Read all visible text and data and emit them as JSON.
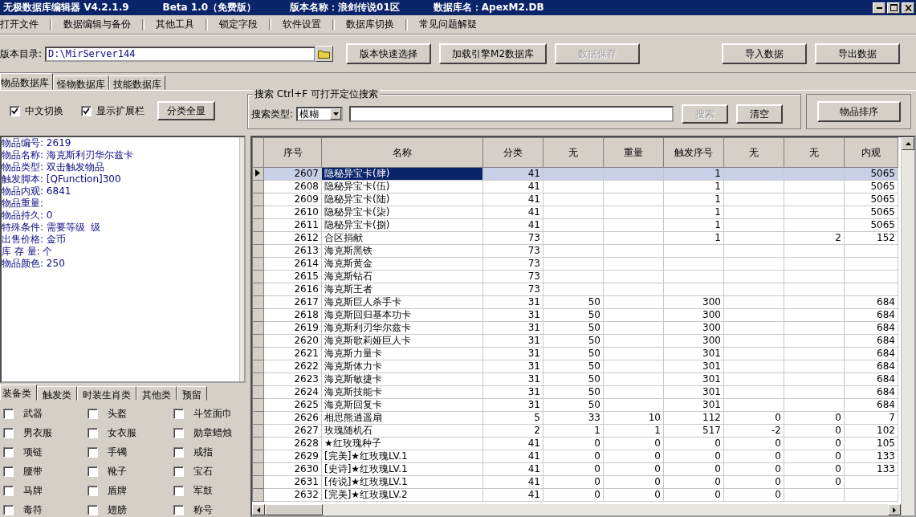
{
  "window": {
    "title_parts": [
      "无极数据库编辑器 V4.2.1.9",
      "Beta 1.0（免费版）",
      "版本名称：浪剑传说01区",
      "数据库名：ApexM2.DB"
    ]
  },
  "menu": [
    "打开文件",
    "数据编辑与备份",
    "其他工具",
    "锁定字段",
    "软件设置",
    "数据库切换",
    "常见问题解疑"
  ],
  "toolbar": {
    "dir_label": "版本目录:",
    "dir_value": "D:\\MirServer144",
    "buttons": [
      {
        "label": "版本快速选择",
        "disabled": false
      },
      {
        "label": "加载引擎M2数据库",
        "disabled": false
      },
      {
        "label": "数据保存",
        "disabled": true
      },
      {
        "label": "导入数据",
        "disabled": false
      },
      {
        "label": "导出数据",
        "disabled": false
      }
    ]
  },
  "tabs": [
    {
      "label": "物品数据库",
      "selected": true
    },
    {
      "label": "怪物数据库",
      "selected": false
    },
    {
      "label": "技能数据库",
      "selected": false
    }
  ],
  "options": [
    {
      "label": "中文切换",
      "checked": true
    },
    {
      "label": "显示扩展栏",
      "checked": true
    }
  ],
  "show_all_button": "分类全显",
  "search": {
    "title": "搜索  Ctrl+F 可打开定位搜索",
    "type_label": "搜索类型:",
    "type_value": "模糊",
    "search_button": {
      "label": "搜索",
      "disabled": true
    },
    "clear_button": "清空"
  },
  "sort_button": "物品排序",
  "details": [
    "物品编号: 2619",
    "物品名称: 海克斯利刃华尔兹卡",
    "物品类型: 双击触发物品",
    "触发脚本: [QFunction]300",
    "物品内观: 6841",
    "物品重量:",
    "物品持久: 0",
    "特殊条件: 需要等级  级",
    "出售价格: 金币",
    "库 存 量: 个",
    "物品颜色: 250"
  ],
  "category_tabs": [
    {
      "label": "装备类",
      "selected": true
    },
    {
      "label": "触发类",
      "selected": false
    },
    {
      "label": "时装生肖类",
      "selected": false
    },
    {
      "label": "其他类",
      "selected": false
    },
    {
      "label": "预留",
      "selected": false
    }
  ],
  "categories": [
    {
      "label": "武器",
      "checked": false
    },
    {
      "label": "头盔",
      "checked": false
    },
    {
      "label": "斗笠面巾",
      "checked": false
    },
    {
      "label": "男衣服",
      "checked": false
    },
    {
      "label": "女衣服",
      "checked": false
    },
    {
      "label": "勋章蜡烛",
      "checked": false
    },
    {
      "label": "项链",
      "checked": false
    },
    {
      "label": "手镯",
      "checked": false
    },
    {
      "label": "戒指",
      "checked": false
    },
    {
      "label": "腰带",
      "checked": false
    },
    {
      "label": "靴子",
      "checked": false
    },
    {
      "label": "宝石",
      "checked": false
    },
    {
      "label": "马牌",
      "checked": false
    },
    {
      "label": "盾牌",
      "checked": false
    },
    {
      "label": "军鼓",
      "checked": false
    },
    {
      "label": "毒符",
      "checked": false
    },
    {
      "label": "翅膀",
      "checked": false
    },
    {
      "label": "称号",
      "checked": false
    }
  ],
  "table": {
    "columns": [
      "序号",
      "名称",
      "分类",
      "无",
      "重量",
      "触发序号",
      "无",
      "无",
      "内观"
    ],
    "rows": [
      {
        "selected": true,
        "cells": [
          "2607",
          "隐秘异宝卡(肆)",
          "41",
          null,
          null,
          "1",
          null,
          null,
          "5065"
        ]
      },
      {
        "selected": false,
        "cells": [
          "2608",
          "隐秘异宝卡(伍)",
          "41",
          null,
          null,
          "1",
          null,
          null,
          "5065"
        ]
      },
      {
        "selected": false,
        "cells": [
          "2609",
          "隐秘异宝卡(陆)",
          "41",
          null,
          null,
          "1",
          null,
          null,
          "5065"
        ]
      },
      {
        "selected": false,
        "cells": [
          "2610",
          "隐秘异宝卡(柒)",
          "41",
          null,
          null,
          "1",
          null,
          null,
          "5065"
        ]
      },
      {
        "selected": false,
        "cells": [
          "2611",
          "隐秘异宝卡(捌)",
          "41",
          null,
          null,
          "1",
          null,
          null,
          "5065"
        ]
      },
      {
        "selected": false,
        "cells": [
          "2612",
          "合区捐献",
          "73",
          null,
          null,
          "1",
          null,
          "2",
          "152"
        ]
      },
      {
        "selected": false,
        "cells": [
          "2613",
          "海克斯黑铁",
          "73",
          null,
          null,
          null,
          null,
          null,
          null
        ]
      },
      {
        "selected": false,
        "cells": [
          "2614",
          "海克斯黄金",
          "73",
          null,
          null,
          null,
          null,
          null,
          null
        ]
      },
      {
        "selected": false,
        "cells": [
          "2615",
          "海克斯钻石",
          "73",
          null,
          null,
          null,
          null,
          null,
          null
        ]
      },
      {
        "selected": false,
        "cells": [
          "2616",
          "海克斯王者",
          "73",
          null,
          null,
          null,
          null,
          null,
          null
        ]
      },
      {
        "selected": false,
        "cells": [
          "2617",
          "海克斯巨人杀手卡",
          "31",
          "50",
          null,
          "300",
          null,
          null,
          "684"
        ]
      },
      {
        "selected": false,
        "cells": [
          "2618",
          "海克斯回归基本功卡",
          "31",
          "50",
          null,
          "300",
          null,
          null,
          "684"
        ]
      },
      {
        "selected": false,
        "cells": [
          "2619",
          "海克斯利刃华尔兹卡",
          "31",
          "50",
          null,
          "300",
          null,
          null,
          "684"
        ]
      },
      {
        "selected": false,
        "cells": [
          "2620",
          "海克斯歌莉娅巨人卡",
          "31",
          "50",
          null,
          "300",
          null,
          null,
          "684"
        ]
      },
      {
        "selected": false,
        "cells": [
          "2621",
          "海克斯力量卡",
          "31",
          "50",
          null,
          "301",
          null,
          null,
          "684"
        ]
      },
      {
        "selected": false,
        "cells": [
          "2622",
          "海克斯体力卡",
          "31",
          "50",
          null,
          "301",
          null,
          null,
          "684"
        ]
      },
      {
        "selected": false,
        "cells": [
          "2623",
          "海克斯敏捷卡",
          "31",
          "50",
          null,
          "301",
          null,
          null,
          "684"
        ]
      },
      {
        "selected": false,
        "cells": [
          "2624",
          "海克斯技能卡",
          "31",
          "50",
          null,
          "301",
          null,
          null,
          "684"
        ]
      },
      {
        "selected": false,
        "cells": [
          "2625",
          "海克斯回复卡",
          "31",
          "50",
          null,
          "301",
          null,
          null,
          "684"
        ]
      },
      {
        "selected": false,
        "cells": [
          "2626",
          "相思熊逍遥扇",
          "5",
          "33",
          "10",
          "112",
          "0",
          "0",
          "7"
        ]
      },
      {
        "selected": false,
        "cells": [
          "2627",
          "玫瑰随机石",
          "2",
          "1",
          "1",
          "517",
          "-2",
          "0",
          "102"
        ]
      },
      {
        "selected": false,
        "cells": [
          "2628",
          "★红玫瑰种子",
          "41",
          "0",
          "0",
          "0",
          "0",
          "0",
          "105"
        ]
      },
      {
        "selected": false,
        "cells": [
          "2629",
          "[完美]★红玫瑰LV.1",
          "41",
          "0",
          "0",
          "0",
          "0",
          "0",
          "133"
        ]
      },
      {
        "selected": false,
        "cells": [
          "2630",
          "[史诗]★红玫瑰LV.1",
          "41",
          "0",
          "0",
          "0",
          "0",
          "0",
          "133"
        ]
      },
      {
        "selected": false,
        "cells": [
          "2631",
          "[传说]★红玫瑰LV.1",
          "41",
          "0",
          "0",
          "0",
          "0",
          "0",
          null
        ]
      },
      {
        "selected": false,
        "cells": [
          "2632",
          "[完美]★红玫瑰LV.2",
          "41",
          "0",
          "0",
          "0",
          "0",
          null,
          null
        ]
      }
    ]
  }
}
